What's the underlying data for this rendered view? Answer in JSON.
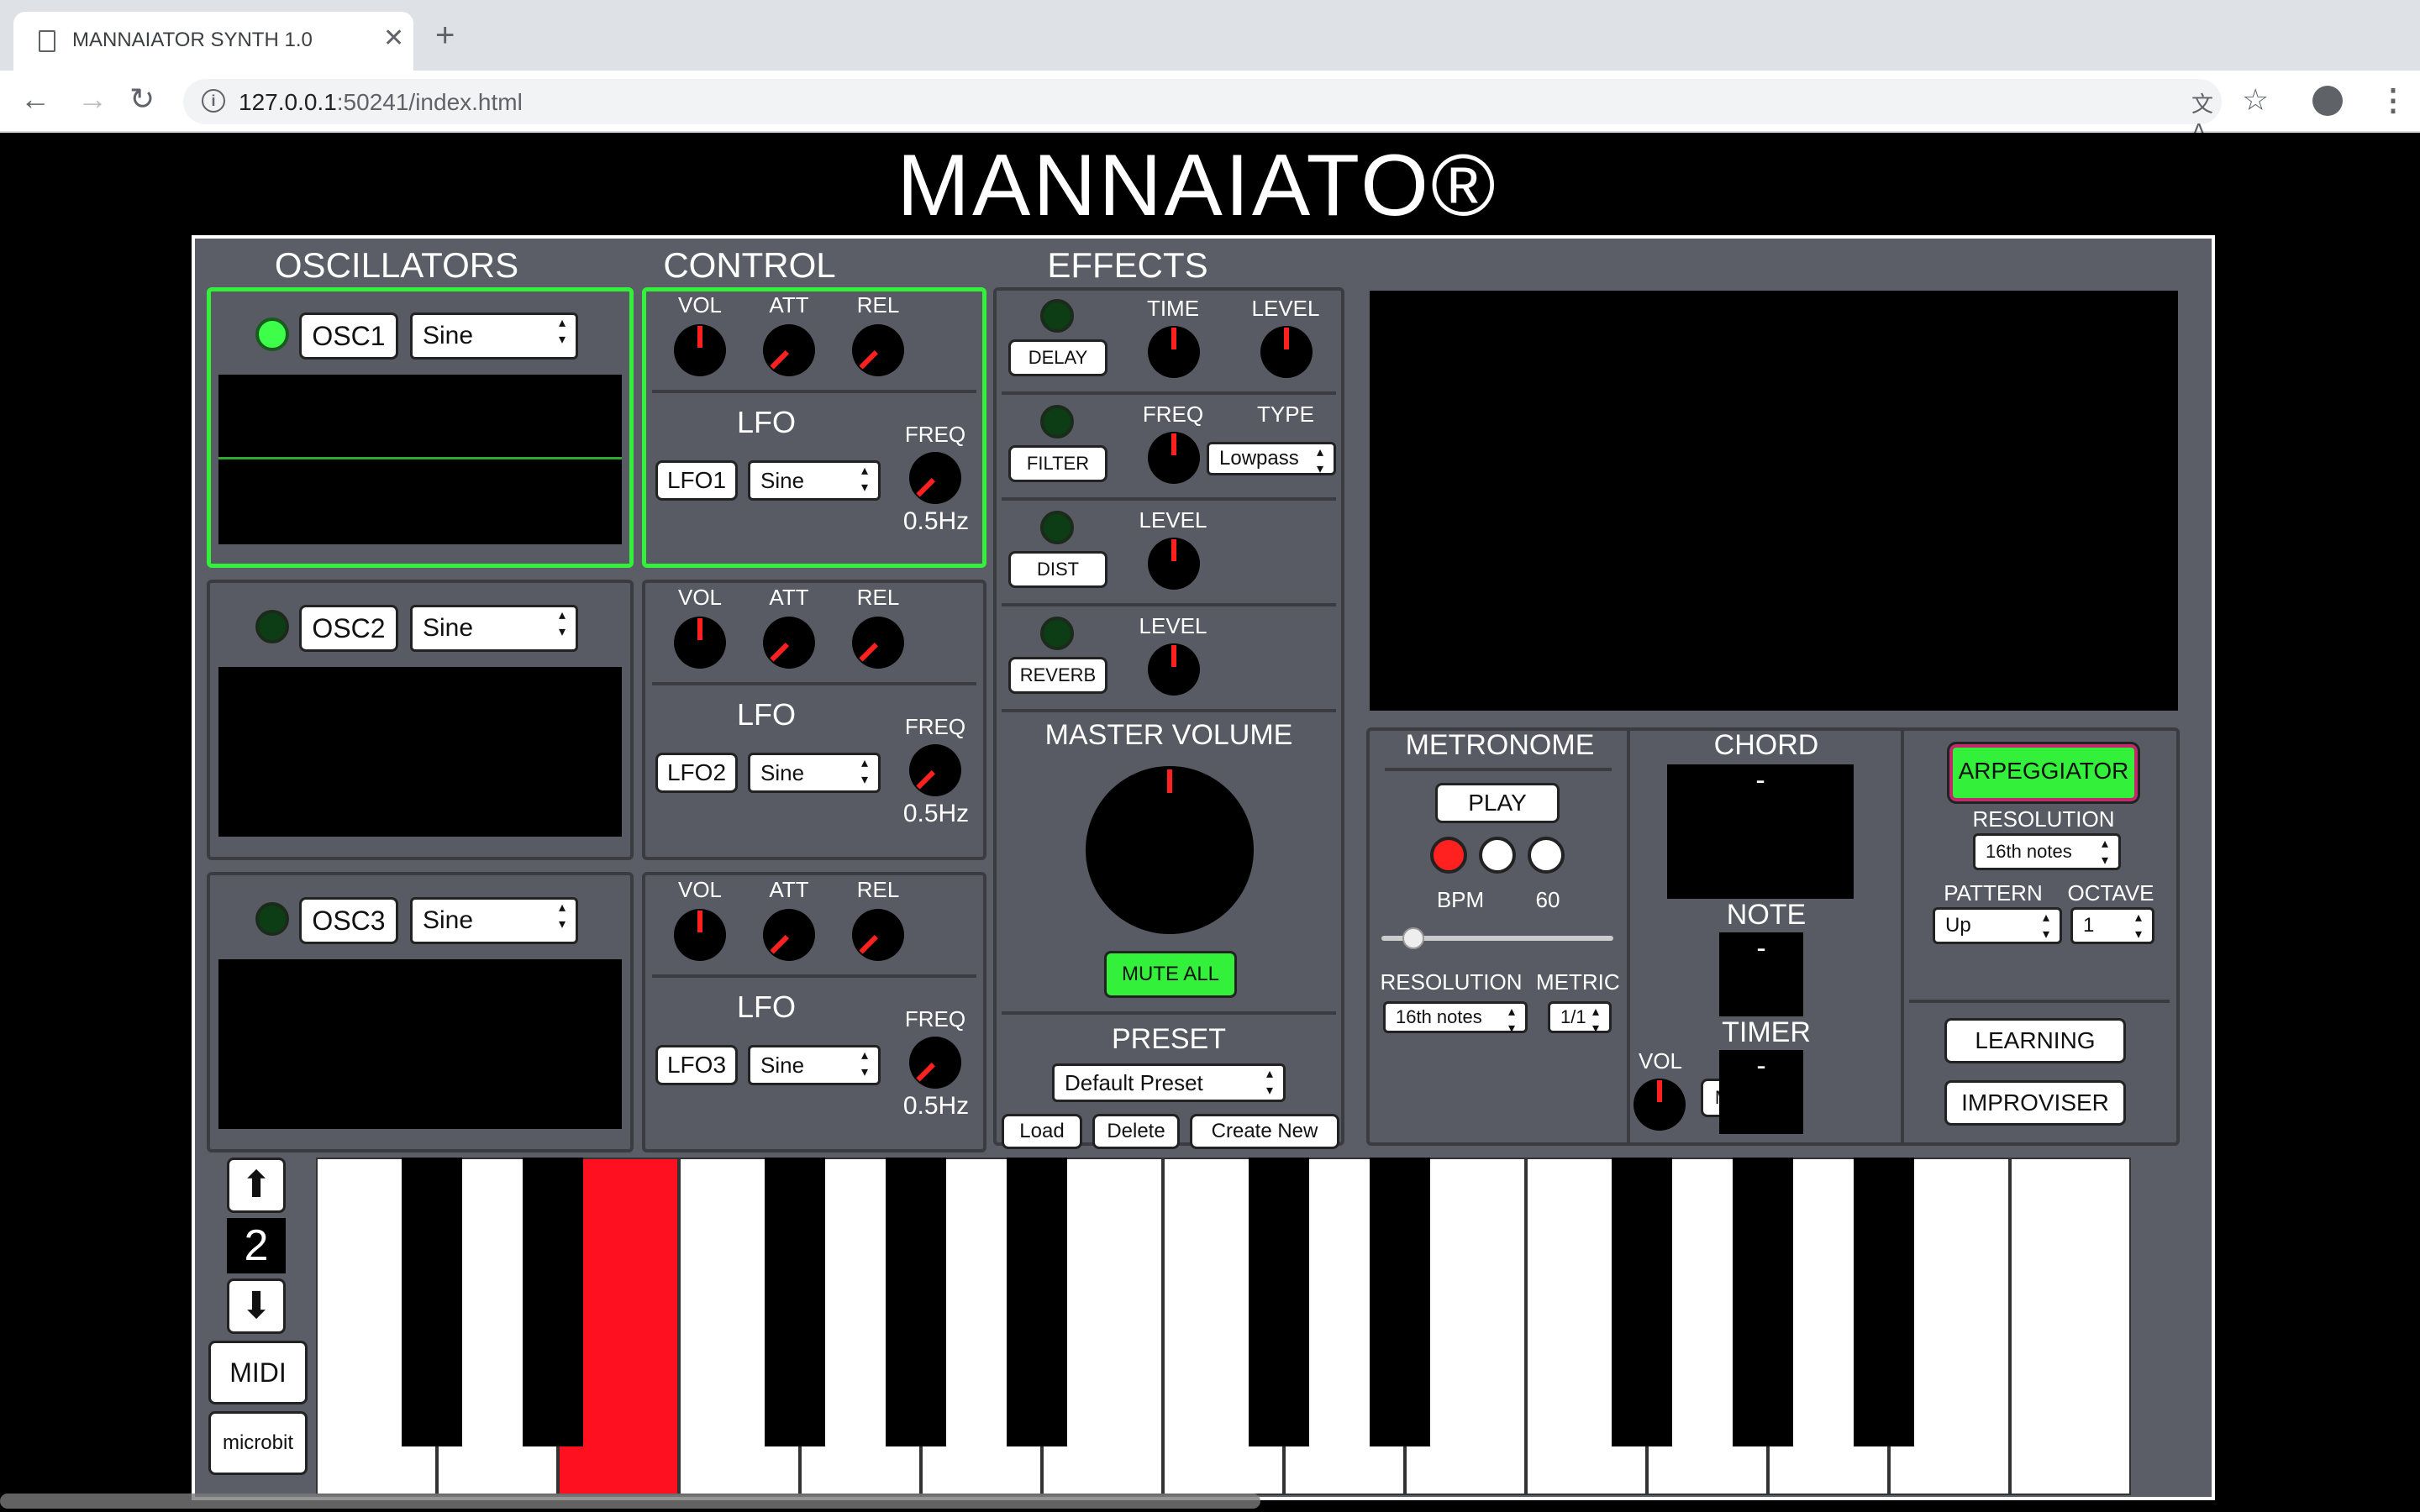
{
  "browser": {
    "tab_title": "MANNAIATOR SYNTH 1.0",
    "url_host": "127.0.0.1",
    "url_rest": ":50241/index.html"
  },
  "brand": "MANNAIATO®",
  "headings": {
    "osc": "OSCILLATORS",
    "control": "CONTROL",
    "effects": "EFFECTS"
  },
  "osc": [
    {
      "label": "OSC1",
      "wave": "Sine",
      "active": true
    },
    {
      "label": "OSC2",
      "wave": "Sine",
      "active": false
    },
    {
      "label": "OSC3",
      "wave": "Sine",
      "active": false
    }
  ],
  "control": {
    "vol": "VOL",
    "att": "ATT",
    "rel": "REL",
    "lfo": "LFO",
    "freq": "FREQ",
    "lfos": [
      {
        "label": "LFO1",
        "wave": "Sine",
        "rate": "0.5Hz"
      },
      {
        "label": "LFO2",
        "wave": "Sine",
        "rate": "0.5Hz"
      },
      {
        "label": "LFO3",
        "wave": "Sine",
        "rate": "0.5Hz"
      }
    ]
  },
  "effects": {
    "delay": "DELAY",
    "time": "TIME",
    "level": "LEVEL",
    "filter": "FILTER",
    "freq": "FREQ",
    "type": "TYPE",
    "filter_type": "Lowpass",
    "dist": "DIST",
    "reverb": "REVERB"
  },
  "master": {
    "title": "MASTER VOLUME",
    "mute_all": "MUTE ALL"
  },
  "preset": {
    "title": "PRESET",
    "selected": "Default Preset",
    "load": "Load",
    "delete": "Delete",
    "create": "Create New"
  },
  "metronome": {
    "title": "METRONOME",
    "play": "PLAY",
    "bpm_label": "BPM",
    "bpm": "60",
    "bpm_fraction": 0.1,
    "resolution_label": "RESOLUTION",
    "metric_label": "METRIC",
    "resolution": "16th notes",
    "metric": "1/1",
    "vol": "VOL",
    "mute": "MUTE"
  },
  "chord": {
    "title": "CHORD",
    "value": "-",
    "note_title": "NOTE",
    "note": "-",
    "timer_title": "TIMER",
    "timer": "-"
  },
  "arp": {
    "title": "ARPEGGIATOR",
    "resolution_label": "RESOLUTION",
    "resolution": "16th notes",
    "pattern_label": "PATTERN",
    "pattern": "Up",
    "octave_label": "OCTAVE",
    "octave": "1",
    "learning": "LEARNING",
    "improviser": "IMPROVISER"
  },
  "keyboard": {
    "octave": "2",
    "up": "⬆",
    "down": "⬇",
    "midi": "MIDI",
    "microbit": "microbit",
    "pressed_white_key": 2
  },
  "colors": {
    "accent_green": "#33f03a",
    "key_pressed": "#ff1020",
    "knob_indicator": "#ff2020",
    "panel": "#5b5e66"
  }
}
